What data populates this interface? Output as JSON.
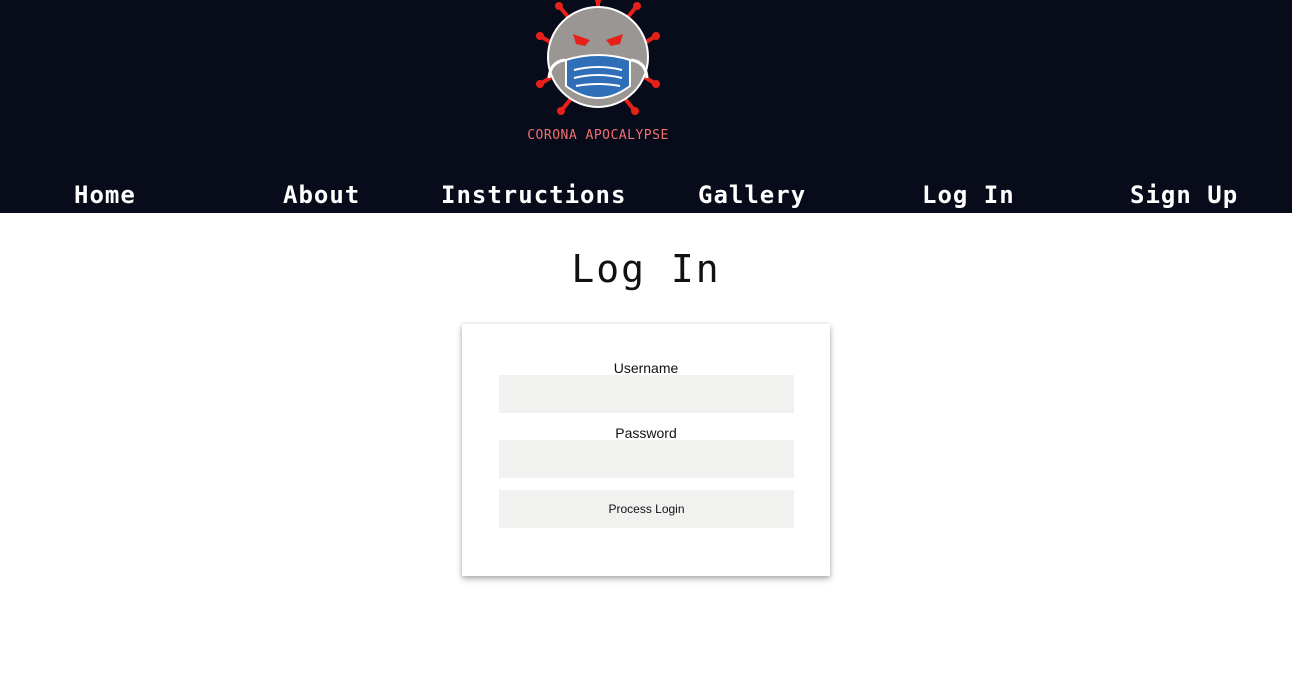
{
  "brand": {
    "name": "CORONA APOCALYPSE",
    "logo_icon": "masked-virus-icon"
  },
  "nav": {
    "items": [
      {
        "label": "Home"
      },
      {
        "label": "About"
      },
      {
        "label": "Instructions"
      },
      {
        "label": "Gallery"
      },
      {
        "label": "Log In"
      },
      {
        "label": "Sign Up"
      }
    ]
  },
  "page": {
    "title": "Log In"
  },
  "form": {
    "username_label": "Username",
    "username_value": "",
    "password_label": "Password",
    "password_value": "",
    "submit_label": "Process Login"
  },
  "colors": {
    "header_bg": "#080b1a",
    "nav_text": "#ffffff",
    "brand_text": "#f07070",
    "input_bg": "#f1f1f0",
    "virus_red": "#e8201a",
    "virus_body": "#9a9694",
    "mask_blue": "#2e6fb8"
  }
}
